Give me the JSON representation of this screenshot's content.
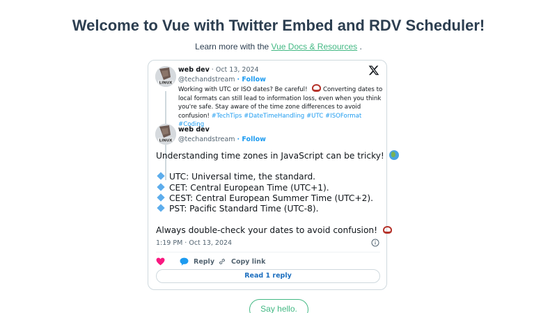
{
  "header": {
    "title": "Welcome to Vue with Twitter Embed and RDV Scheduler!",
    "learn_prefix": "Learn more with the",
    "learn_link": "Vue Docs & Resources",
    "learn_suffix": "."
  },
  "tweet": {
    "quoted": {
      "name": "web dev",
      "date": "· Oct 13, 2024",
      "handle": "@techandstream",
      "follow": "· Follow",
      "avatar_label": "LINUX",
      "text_line1": "Working with UTC or ISO dates? Be careful!",
      "text_line1b": "Converting dates to",
      "text_line2": "local formats can still lead to information loss, even when you think",
      "text_line3": "you're safe. Stay aware of the time zone differences to avoid",
      "text_line4_prefix": "confusion!",
      "hashtags": [
        "#TechTips",
        "#DateTimeHandling",
        "#UTC",
        "#ISOFormat",
        "#Coding"
      ]
    },
    "main": {
      "name": "web dev",
      "handle": "@techandstream",
      "follow": "· Follow",
      "avatar_label": "LINUX",
      "intro": "Understanding time zones in JavaScript can be tricky!",
      "bullets": [
        "UTC: Universal time, the standard.",
        "CET: Central European Time (UTC+1).",
        "CEST: Central European Summer Time (UTC+2).",
        "PST: Pacific Standard Time (UTC-8)."
      ],
      "closing": "Always double-check your dates to avoid confusion!",
      "timestamp": "1:19 PM · Oct 13, 2024"
    },
    "actions": {
      "reply": "Reply",
      "copy_link": "Copy link",
      "read_replies": "Read 1 reply"
    },
    "colors": {
      "accent": "#1d9bf0",
      "like": "#f91880",
      "vue_green": "#42b883"
    }
  },
  "footer": {
    "hello_button": "Say hello."
  }
}
